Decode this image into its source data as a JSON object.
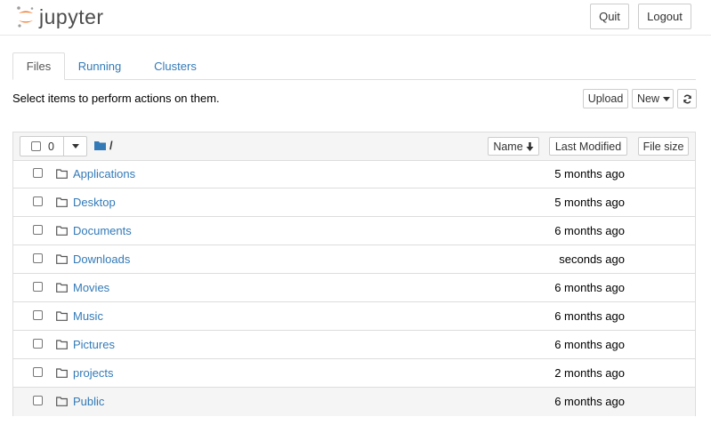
{
  "header": {
    "logo_text": "jupyter",
    "quit_label": "Quit",
    "logout_label": "Logout",
    "colors": {
      "logo_orange": "#f37726",
      "logo_gray": "#9e9e9e"
    }
  },
  "tabs": [
    {
      "label": "Files",
      "active": true
    },
    {
      "label": "Running",
      "active": false
    },
    {
      "label": "Clusters",
      "active": false
    }
  ],
  "toolbar": {
    "hint": "Select items to perform actions on them.",
    "upload_label": "Upload",
    "new_label": "New"
  },
  "list_header": {
    "selected_count": "0",
    "path": "/",
    "sort_name_label": "Name",
    "last_modified_label": "Last Modified",
    "file_size_label": "File size"
  },
  "files": [
    {
      "name": "Applications",
      "modified": "5 months ago"
    },
    {
      "name": "Desktop",
      "modified": "5 months ago"
    },
    {
      "name": "Documents",
      "modified": "6 months ago"
    },
    {
      "name": "Downloads",
      "modified": "seconds ago"
    },
    {
      "name": "Movies",
      "modified": "6 months ago"
    },
    {
      "name": "Music",
      "modified": "6 months ago"
    },
    {
      "name": "Pictures",
      "modified": "6 months ago"
    },
    {
      "name": "projects",
      "modified": "2 months ago"
    },
    {
      "name": "Public",
      "modified": "6 months ago"
    }
  ],
  "colors": {
    "link": "#337ab7",
    "folder_blue": "#337ab7"
  }
}
